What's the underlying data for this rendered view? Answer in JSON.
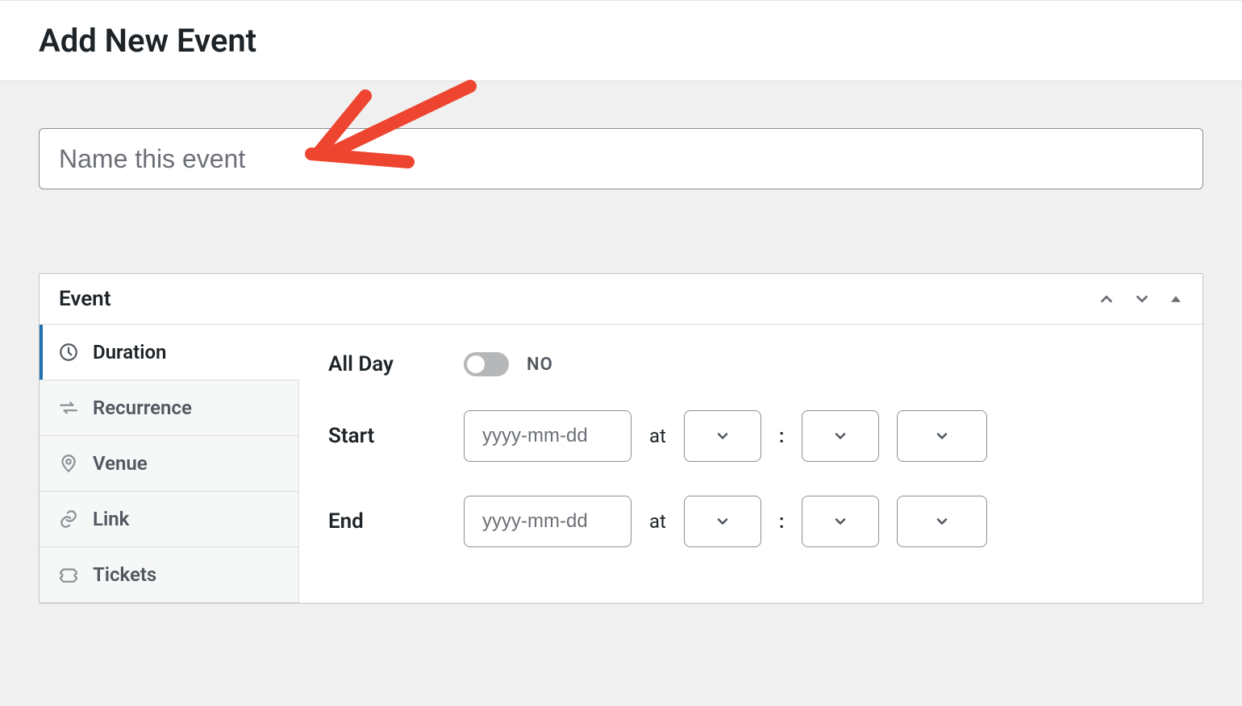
{
  "page": {
    "title": "Add New Event"
  },
  "title_field": {
    "placeholder": "Name this event",
    "value": ""
  },
  "panel": {
    "title": "Event"
  },
  "tabs": {
    "duration": "Duration",
    "recurrence": "Recurrence",
    "venue": "Venue",
    "link": "Link",
    "tickets": "Tickets"
  },
  "fields": {
    "allday_label": "All Day",
    "allday_value": "NO",
    "start_label": "Start",
    "end_label": "End",
    "date_placeholder": "yyyy-mm-dd",
    "at_text": "at",
    "colon": ":"
  }
}
